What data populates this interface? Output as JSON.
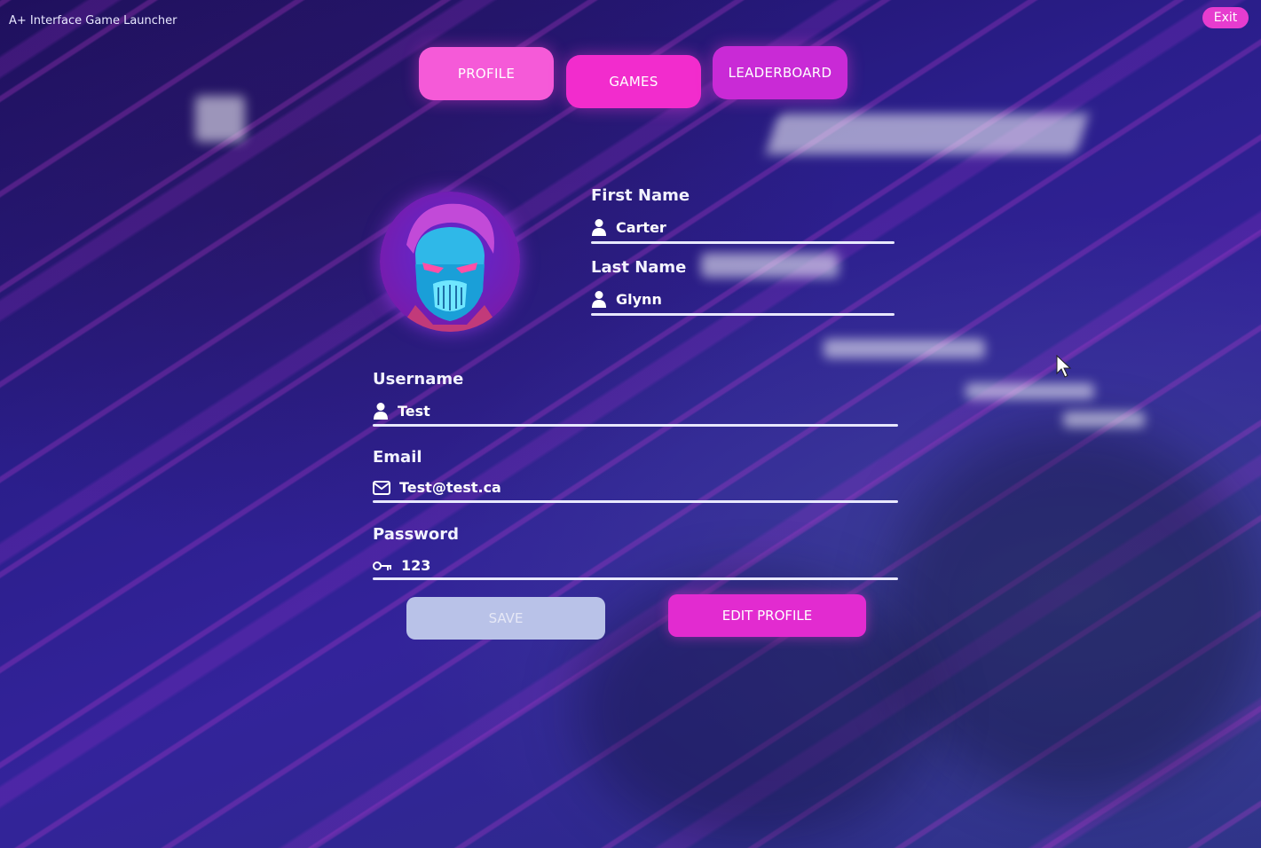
{
  "window": {
    "title": "A+ Interface Game Launcher",
    "exit_label": "Exit"
  },
  "tabs": [
    {
      "label": "PROFILE"
    },
    {
      "label": "GAMES"
    },
    {
      "label": "LEADERBOARD"
    }
  ],
  "profile": {
    "first_name": {
      "label": "First Name",
      "value": "Carter",
      "icon": "user-icon"
    },
    "last_name": {
      "label": "Last Name",
      "value": "Glynn",
      "icon": "user-icon"
    },
    "username": {
      "label": "Username",
      "value": "Test",
      "icon": "user-icon"
    },
    "email": {
      "label": "Email",
      "value": "Test@test.ca",
      "icon": "mail-icon"
    },
    "password": {
      "label": "Password",
      "value": "123",
      "icon": "key-icon"
    }
  },
  "actions": {
    "save_label": "SAVE",
    "edit_label": "EDIT PROFILE"
  },
  "colors": {
    "accent": "#e22bd0",
    "tab_profile": "#f55ad8",
    "tab_games": "#f22ccd",
    "tab_leaderboard": "#c92ad6",
    "save_disabled": "#b9c2e8"
  }
}
